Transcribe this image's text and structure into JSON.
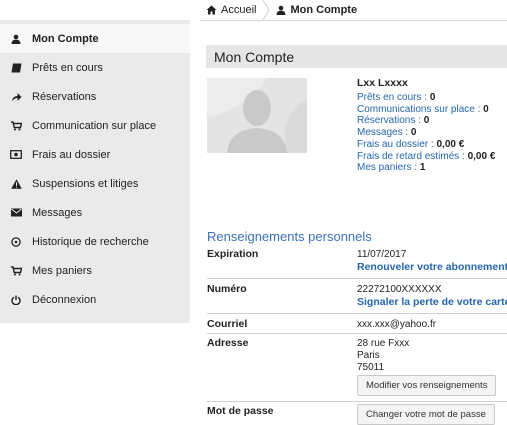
{
  "breadcrumb": {
    "home": "Accueil",
    "current": "Mon Compte"
  },
  "sidebar": {
    "items": [
      {
        "label": "Mon Compte",
        "icon": "user-icon",
        "active": true
      },
      {
        "label": "Prêts en cours",
        "icon": "book-icon"
      },
      {
        "label": "Réservations",
        "icon": "share-arrow-icon"
      },
      {
        "label": "Communication sur place",
        "icon": "cart-icon"
      },
      {
        "label": "Frais au dossier",
        "icon": "money-icon"
      },
      {
        "label": "Suspensions et litiges",
        "icon": "warning-icon"
      },
      {
        "label": "Messages",
        "icon": "envelope-icon"
      },
      {
        "label": "Historique de recherche",
        "icon": "history-icon"
      },
      {
        "label": "Mes paniers",
        "icon": "cart-icon"
      },
      {
        "label": "Déconnexion",
        "icon": "power-icon"
      }
    ]
  },
  "main": {
    "title": "Mon Compte",
    "user_name": "Lxx Lxxxx",
    "summary": [
      {
        "label": "Prêts en cours : ",
        "value": "0"
      },
      {
        "label": "Communications sur place : ",
        "value": "0"
      },
      {
        "label": "Réservations : ",
        "value": "0"
      },
      {
        "label": "Messages : ",
        "value": "0"
      },
      {
        "label": "Frais au dossier : ",
        "value": "0,00 €"
      },
      {
        "label": "Frais de retard estimés : ",
        "value": "0,00 €"
      },
      {
        "label": "Mes paniers : ",
        "value": "1"
      }
    ],
    "section_title": "Renseignements personnels",
    "expiration": {
      "label": "Expiration",
      "value": "11/07/2017",
      "link": "Renouveler votre abonnement"
    },
    "numero": {
      "label": "Numéro",
      "value": "22272100XXXXXX",
      "link": "Signaler la perte de votre carte"
    },
    "courriel": {
      "label": "Courriel",
      "value": "xxx.xxx@yahoo.fr"
    },
    "adresse": {
      "label": "Adresse",
      "line1": "28 rue Fxxx",
      "line2": "Paris",
      "line3": "75011",
      "button": "Modifier vos renseignements"
    },
    "password": {
      "label": "Mot de passe",
      "button": "Changer votre mot de passe"
    }
  },
  "colors": {
    "link": "#2566b0",
    "section_title": "#3a72b8",
    "sidebar_bg": "#eaeaea"
  }
}
